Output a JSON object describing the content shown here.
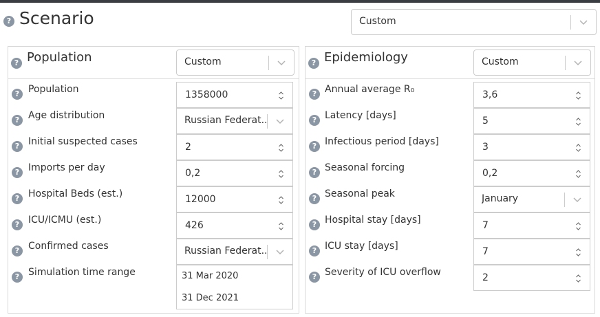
{
  "scenario": {
    "title": "Scenario",
    "preset": "Custom"
  },
  "population": {
    "title": "Population",
    "preset": "Custom",
    "fields": [
      {
        "label": "Population",
        "value": "1358000"
      },
      {
        "label": "Age distribution",
        "value": "Russian Federat..."
      },
      {
        "label": "Initial suspected cases",
        "value": "2"
      },
      {
        "label": "Imports per day",
        "value": "0,2"
      },
      {
        "label": "Hospital Beds (est.)",
        "value": "12000"
      },
      {
        "label": "ICU/ICMU (est.)",
        "value": "426"
      },
      {
        "label": "Confirmed cases",
        "value": "Russian Federat..."
      },
      {
        "label": "Simulation time range",
        "start": "31 Mar 2020",
        "end": "31 Dec 2021"
      }
    ]
  },
  "epidemiology": {
    "title": "Epidemiology",
    "preset": "Custom",
    "fields": [
      {
        "label": "Annual average R₀",
        "value": "3,6"
      },
      {
        "label": "Latency [days]",
        "value": "5"
      },
      {
        "label": "Infectious period [days]",
        "value": "3"
      },
      {
        "label": "Seasonal forcing",
        "value": "0,2"
      },
      {
        "label": "Seasonal peak",
        "value": "January"
      },
      {
        "label": "Hospital stay [days]",
        "value": "7"
      },
      {
        "label": "ICU stay [days]",
        "value": "7"
      },
      {
        "label": "Severity of ICU overflow",
        "value": "2"
      }
    ]
  },
  "help_icon_glyph": "?"
}
